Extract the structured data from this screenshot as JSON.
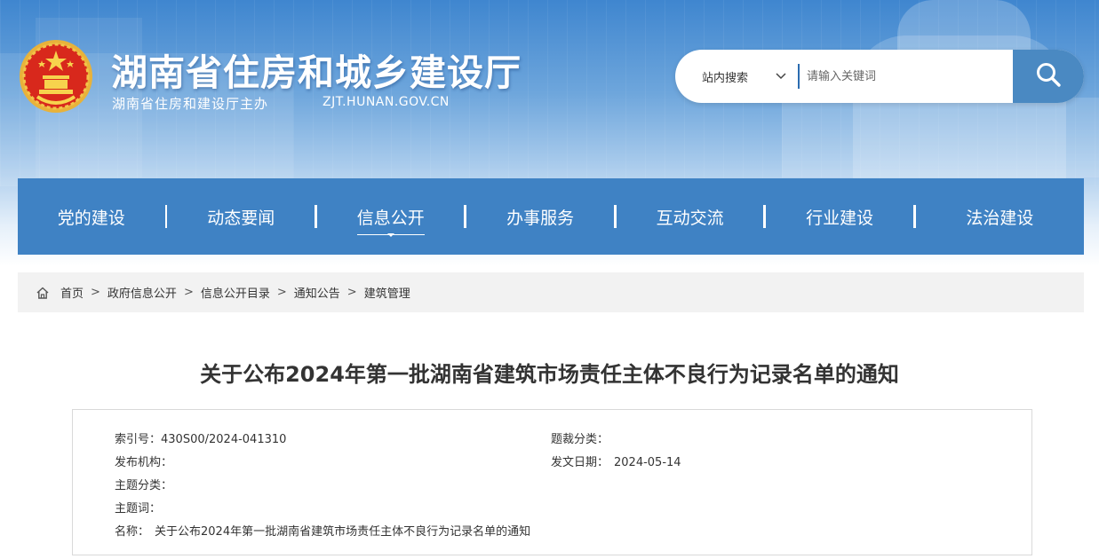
{
  "header": {
    "site_title": "湖南省住房和城乡建设厅",
    "site_sub": "湖南省住房和建设厅主办",
    "site_domain": "ZJT.HUNAN.GOV.CN",
    "emblem_icon": "national-emblem-icon"
  },
  "search": {
    "scope": "站内搜索",
    "placeholder": "请输入关键词",
    "button_icon": "search-icon"
  },
  "nav": {
    "items": [
      {
        "label": "党的建设"
      },
      {
        "label": "动态要闻"
      },
      {
        "label": "信息公开",
        "active": true
      },
      {
        "label": "办事服务"
      },
      {
        "label": "互动交流"
      },
      {
        "label": "行业建设"
      },
      {
        "label": "法治建设"
      }
    ]
  },
  "breadcrumb": {
    "items": [
      "首页",
      "政府信息公开",
      "信息公开目录",
      "通知公告",
      "建筑管理"
    ]
  },
  "article": {
    "title": "关于公布2024年第一批湖南省建筑市场责任主体不良行为记录名单的通知"
  },
  "meta": {
    "index_label": "索引号：",
    "index_value": "430S00/2024-041310",
    "category_label": "题裁分类：",
    "category_value": "",
    "publisher_label": "发布机构：",
    "publisher_value": "",
    "date_label": "发文日期：",
    "date_value": "2024-05-14",
    "topic_label": "主题分类：",
    "topic_value": "",
    "keywords_label": "主题词：",
    "keywords_value": "",
    "name_label": "名称：",
    "name_value": "关于公布2024年第一批湖南省建筑市场责任主体不良行为记录名单的通知"
  },
  "colors": {
    "nav_bg": "#3f82c4",
    "search_btn": "#4a89c2",
    "breadcrumb_bg": "#f2f2f2"
  }
}
